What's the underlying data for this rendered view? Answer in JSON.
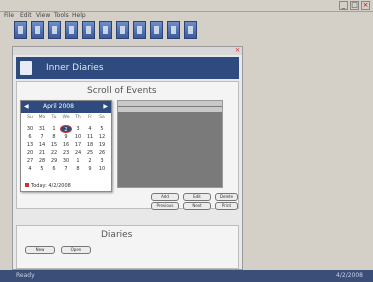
{
  "main_window": {
    "title": "",
    "controls": [
      "_",
      "□",
      "×"
    ]
  },
  "menubar": {
    "items": [
      "File",
      "Edit",
      "View",
      "Tools",
      "Help"
    ]
  },
  "toolbar": {
    "buttons": [
      "new",
      "open",
      "edit",
      "delete",
      "print",
      "calendar",
      "notes",
      "settings",
      "help",
      "users",
      "reports"
    ]
  },
  "child_window": {
    "app_name": "Inner Diaries",
    "close_label": "×"
  },
  "events_panel": {
    "title": "Scroll of Events",
    "buttons_row1": [
      "Add",
      "Edit",
      "Delete"
    ],
    "buttons_row2": [
      "Previous",
      "Next",
      "Print"
    ]
  },
  "calendar": {
    "month_label": "April 2008",
    "prev": "◀",
    "next": "▶",
    "days_of_week": [
      "Su",
      "Mo",
      "Tu",
      "We",
      "Th",
      "Fr",
      "Sa"
    ],
    "weeks": [
      [
        "30",
        "31",
        "1",
        "2",
        "3",
        "4",
        "5"
      ],
      [
        "6",
        "7",
        "8",
        "9",
        "10",
        "11",
        "12"
      ],
      [
        "13",
        "14",
        "15",
        "16",
        "17",
        "18",
        "19"
      ],
      [
        "20",
        "21",
        "22",
        "23",
        "24",
        "25",
        "26"
      ],
      [
        "27",
        "28",
        "29",
        "30",
        "1",
        "2",
        "3"
      ],
      [
        "4",
        "5",
        "6",
        "7",
        "8",
        "9",
        "10"
      ]
    ],
    "selected_day": "2",
    "today_label": "Today: 4/2/2008"
  },
  "notes_panel": {
    "title": "Diaries",
    "buttons": [
      "New",
      "Open"
    ]
  },
  "status_bar": {
    "left": "Ready",
    "right": "4/2/2008"
  },
  "colors": {
    "desktop": "#2d3f66",
    "header_blue": "#2e4a7e",
    "window_gray": "#d4d0c8"
  }
}
